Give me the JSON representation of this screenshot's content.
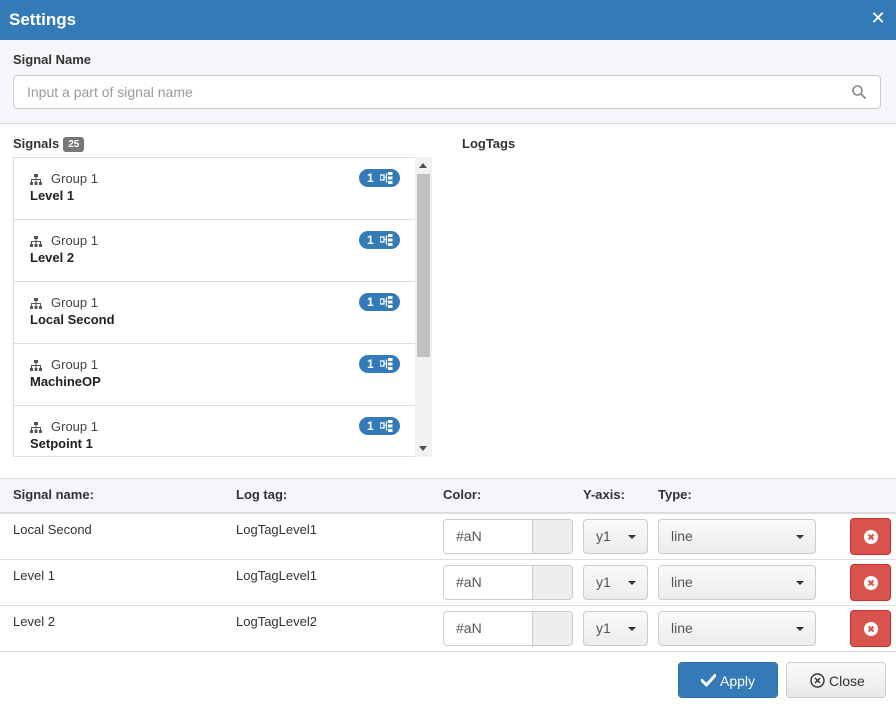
{
  "dialog": {
    "title": "Settings"
  },
  "search": {
    "label": "Signal Name",
    "placeholder": "Input a part of signal name"
  },
  "signals": {
    "label": "Signals",
    "count": "25",
    "items": [
      {
        "group": "Group 1",
        "name": "Level 1",
        "badge": "1"
      },
      {
        "group": "Group 1",
        "name": "Level 2",
        "badge": "1"
      },
      {
        "group": "Group 1",
        "name": "Local Second",
        "badge": "1"
      },
      {
        "group": "Group 1",
        "name": "MachineOP",
        "badge": "1"
      },
      {
        "group": "Group 1",
        "name": "Setpoint 1",
        "badge": "1"
      }
    ]
  },
  "logtags": {
    "label": "LogTags"
  },
  "table": {
    "headers": {
      "signal": "Signal name:",
      "logtag": "Log tag:",
      "color": "Color:",
      "yaxis": "Y-axis:",
      "type": "Type:"
    },
    "rows": [
      {
        "signal": "Local Second",
        "logtag": "LogTagLevel1",
        "color": "#aN",
        "yaxis": "y1",
        "type": "line"
      },
      {
        "signal": "Level 1",
        "logtag": "LogTagLevel1",
        "color": "#aN",
        "yaxis": "y1",
        "type": "line"
      },
      {
        "signal": "Level 2",
        "logtag": "LogTagLevel2",
        "color": "#aN",
        "yaxis": "y1",
        "type": "line"
      }
    ]
  },
  "footer": {
    "apply_label": "Apply",
    "close_label": "Close"
  },
  "colors": {
    "primary": "#337ab7",
    "danger": "#d9534f",
    "badge_gray": "#777777"
  },
  "icons": {
    "close": "close-icon",
    "search": "search-icon",
    "group": "sitemap-icon",
    "tag": "logtag-icon",
    "delete": "times-circle-icon",
    "apply": "check-icon",
    "close_button": "times-circle-outline-icon"
  }
}
